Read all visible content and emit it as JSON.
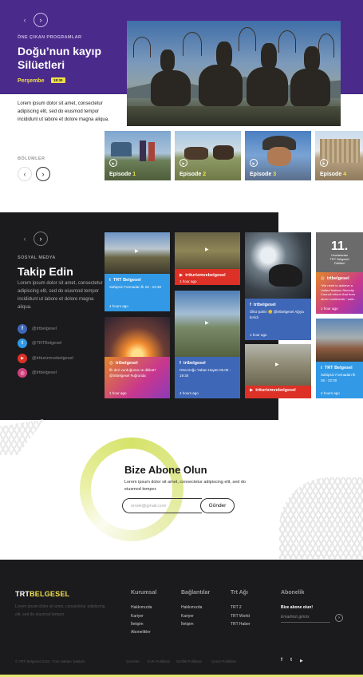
{
  "hero": {
    "kicker": "ÖNE ÇIKAN PROGRAMLAR",
    "title": "Doğu’nun kayıp Silüetleri",
    "day": "Perşembe",
    "time": "18:30",
    "description": "Lorem ipsum dolor sit amet, consectetur adipiscing elit, sed do eiusmod tempor incididunt ut labore et dolore magna aliqua.",
    "prev_icon": "chevron-left-icon",
    "next_icon": "chevron-right-icon"
  },
  "episodes": {
    "label": "BÖLÜMLER",
    "items": [
      {
        "label": "Episode",
        "num": "1"
      },
      {
        "label": "Episode",
        "num": "2"
      },
      {
        "label": "Episode",
        "num": "3"
      },
      {
        "label": "Episode",
        "num": "4"
      }
    ]
  },
  "social": {
    "kicker": "SOSYAL MEDYA",
    "title": "Takip Edin",
    "description": "Lorem ipsum dolor sit amet, consectetur adipiscing elit, sed do eiusmod tempor incididunt ut labore et dolore magna aliqua.",
    "accounts": [
      {
        "icon": "facebook-icon",
        "glyph": "f",
        "name": "@trtbelgesel",
        "color": "#3f67b7"
      },
      {
        "icon": "twitter-icon",
        "glyph": "t",
        "name": "@TRTBelgesel",
        "color": "#3199e6"
      },
      {
        "icon": "youtube-icon",
        "glyph": "▶",
        "name": "@trtturizmvebelgesel",
        "color": "#dd3026"
      },
      {
        "icon": "instagram-icon",
        "glyph": "◎",
        "name": "@trtbelgesel",
        "color": "#d0417e"
      }
    ],
    "cards": {
      "c1": {
        "account": "TRT Belgesel",
        "text": "Sahipsiz Formadan fk 26 - 22:30",
        "time": "4 hours ago",
        "icon": "twitter-icon"
      },
      "c2": {
        "account": "trtturizmvebelgesel",
        "time": "1 hour ago",
        "icon": "youtube-icon"
      },
      "c3": {
        "account": "trtbelgesel",
        "text": "İlk deri vurduğuma ne dikkat? @trtbelgesel #uğrunda",
        "time": "1 hour ago",
        "icon": "instagram-icon"
      },
      "c4": {
        "account": "trtbelgesel",
        "text": "Orta Doğu Yaban Hayatı 05.05 - 19:30",
        "time": "4 hours ago",
        "icon": "facebook-icon"
      },
      "c5": {
        "account": "trtbelgesel",
        "text": "Ülkü Şahin 🙂 @trtbelgesel Ağıya kırıldı",
        "time": "1 hour ago",
        "icon": "facebook-icon"
      },
      "c6": {
        "account": "trtturizmvebelgesel",
        "icon": "youtube-icon"
      },
      "c7": {
        "account": "trtbelgesel",
        "text": "“We need to achieve a United Nations Security Council reform that from seven continents,” said...",
        "time": "1 hour ago",
        "icon": "instagram-icon",
        "badge_num": "11.",
        "badge_l1": "Uluslararası",
        "badge_l2": "TRT Belgesel",
        "badge_l3": "Ödülleri"
      },
      "c8": {
        "account": "TRT Belgesel",
        "text": "Sahipsiz Formadan fk 26 - 22:30",
        "time": "4 hours ago",
        "icon": "twitter-icon"
      }
    }
  },
  "subscribe": {
    "title": "Bize Abone Olun",
    "description": "Lorem ipsum dolor sit amet, consectetur adipiscing elit, sed do eiusmod tempor.",
    "placeholder": "ornek@gmail.com",
    "button": "Gönder"
  },
  "footer": {
    "logo_a": "TRT",
    "logo_b": "BELGESEL",
    "about": "Lorem ipsum dolor sit amet, consectetur adipiscing elit, sed do eiusmod tempor.",
    "cols": [
      {
        "title": "Kurumsal",
        "links": [
          "Hakkımızda",
          "Kariyer",
          "İletişim",
          "Abonelikler"
        ]
      },
      {
        "title": "Bağlantılar",
        "links": [
          "Hakkımızda",
          "Kariyer",
          "İletişim"
        ]
      },
      {
        "title": "Trt Ağı",
        "links": [
          "TRT 2",
          "TRT World",
          "TRT Haber"
        ]
      }
    ],
    "newsletter": {
      "title": "Abonelik",
      "label": "Bize abone olun!",
      "placeholder": "Emailinizi girinix",
      "button_icon": "chevron-right-icon"
    },
    "copyright": "© TRT Belgesel 2018 . Tüm Hakları Saklıdır.",
    "bottom_links": [
      "Çerezler",
      "KVK Politikası",
      "Gizlilik Politikası",
      "Çerez Politikası"
    ],
    "social_icons": [
      {
        "icon": "facebook-icon",
        "glyph": "f"
      },
      {
        "icon": "twitter-icon",
        "glyph": "t"
      },
      {
        "icon": "youtube-icon",
        "glyph": "▶"
      }
    ]
  }
}
